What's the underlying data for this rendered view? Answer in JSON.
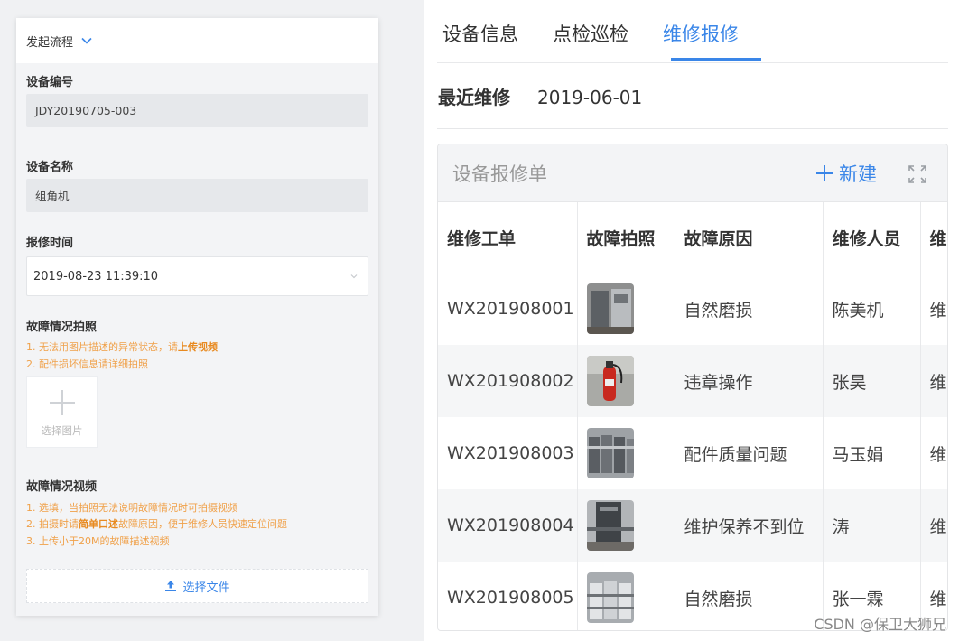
{
  "form": {
    "header_label": "发起流程",
    "device_no_label": "设备编号",
    "device_no_value": "JDY20190705-003",
    "device_name_label": "设备名称",
    "device_name_value": "组角机",
    "report_time_label": "报修时间",
    "report_time_value": "2019-08-23 11:39:10",
    "photo_label": "故障情况拍照",
    "photo_tip1_prefix": "1. 无法用图片描述的异常状态，请",
    "photo_tip1_bold": "上传视频",
    "photo_tip2": "2. 配件损坏信息请详细拍照",
    "photo_button_label": "选择图片",
    "video_label": "故障情况视频",
    "video_tip1": "1. 选填，当拍照无法说明故障情况时可拍摄视频",
    "video_tip2_prefix": "2. 拍摄时请",
    "video_tip2_bold": "简单口述",
    "video_tip2_suffix": "故障原因，便于维修人员快速定位问题",
    "video_tip3": "3. 上传小于20M的故障描述视频",
    "file_button_label": "选择文件"
  },
  "tabs": [
    {
      "label": "设备信息",
      "active": false
    },
    {
      "label": "点检巡检",
      "active": false
    },
    {
      "label": "维修报修",
      "active": true
    }
  ],
  "recent": {
    "label": "最近维修",
    "value": "2019-06-01"
  },
  "repair_card": {
    "title": "设备报修单",
    "new_label": "新建",
    "columns": [
      "维修工单",
      "故障拍照",
      "故障原因",
      "维修人员",
      "维"
    ],
    "rows": [
      {
        "order": "WX201908001",
        "reason": "自然磨损",
        "person": "陈美机",
        "extra": "维"
      },
      {
        "order": "WX201908002",
        "reason": "违章操作",
        "person": "张昊",
        "extra": "维"
      },
      {
        "order": "WX201908003",
        "reason": "配件质量问题",
        "person": "马玉娟",
        "extra": "维"
      },
      {
        "order": "WX201908004",
        "reason": "维护保养不到位",
        "person": "涛",
        "extra": "维"
      },
      {
        "order": "WX201908005",
        "reason": "自然磨损",
        "person": "张一霖",
        "extra": "维"
      }
    ]
  },
  "watermark": "CSDN @保卫大狮兄",
  "colors": {
    "accent": "#3a86e8",
    "tip": "#f0a14a"
  }
}
